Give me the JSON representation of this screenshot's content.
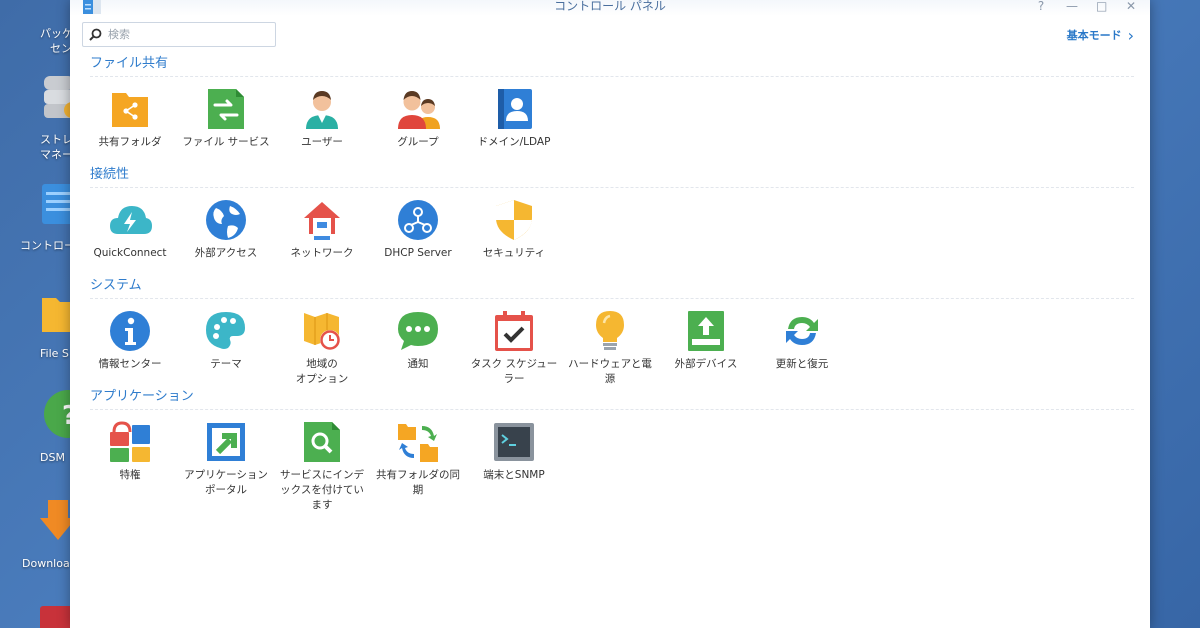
{
  "desktop": {
    "items": [
      {
        "label_1": "パッケ",
        "label_2": "セン"
      },
      {
        "label_1": "ストレ",
        "label_2": "マネー"
      },
      {
        "label_1": "コントロー",
        "label_2": ""
      },
      {
        "label_1": "File S",
        "label_2": ""
      },
      {
        "label_1": "DSM",
        "label_2": ""
      },
      {
        "label_1": "Downloa",
        "label_2": ""
      }
    ]
  },
  "window": {
    "title": "コントロール パネル",
    "controls": {
      "help": "?",
      "minimize": "—",
      "maximize": "□",
      "close": "✕"
    }
  },
  "search": {
    "placeholder": "検索"
  },
  "basic_mode": {
    "label": "基本モード",
    "chevron": "›"
  },
  "sections": [
    {
      "title": "ファイル共有",
      "items": [
        {
          "label": "共有フォルダ",
          "icon": "shared-folder-icon"
        },
        {
          "label": "ファイル サービス",
          "icon": "file-services-icon"
        },
        {
          "label": "ユーザー",
          "icon": "user-icon"
        },
        {
          "label": "グループ",
          "icon": "group-icon"
        },
        {
          "label": "ドメイン/LDAP",
          "icon": "domain-ldap-icon"
        }
      ]
    },
    {
      "title": "接続性",
      "items": [
        {
          "label": "QuickConnect",
          "icon": "quickconnect-icon"
        },
        {
          "label": "外部アクセス",
          "icon": "globe-icon"
        },
        {
          "label": "ネットワーク",
          "icon": "network-house-icon"
        },
        {
          "label": "DHCP Server",
          "icon": "dhcp-icon"
        },
        {
          "label": "セキュリティ",
          "icon": "shield-icon"
        }
      ]
    },
    {
      "title": "システム",
      "items": [
        {
          "label": "情報センター",
          "label_2": "",
          "icon": "info-icon"
        },
        {
          "label": "テーマ",
          "label_2": "",
          "icon": "palette-icon"
        },
        {
          "label": "地域の",
          "label_2": "オプション",
          "icon": "map-clock-icon"
        },
        {
          "label": "通知",
          "label_2": "",
          "icon": "chat-bubble-icon"
        },
        {
          "label": "タスク スケジュー",
          "label_2": "ラー",
          "icon": "calendar-check-icon"
        },
        {
          "label": "ハードウェアと電",
          "label_2": "源",
          "icon": "lightbulb-icon"
        },
        {
          "label": "外部デバイス",
          "label_2": "",
          "icon": "upload-device-icon"
        },
        {
          "label": "更新と復元",
          "label_2": "",
          "icon": "refresh-icon"
        }
      ]
    },
    {
      "title": "アプリケーション",
      "items": [
        {
          "label": "特権",
          "label_2": "",
          "label_3": "",
          "icon": "privileges-icon"
        },
        {
          "label": "アプリケーション",
          "label_2": "ポータル",
          "label_3": "",
          "icon": "app-portal-icon"
        },
        {
          "label": "サービスにインデ",
          "label_2": "ックスを付けてい",
          "label_3": "ます",
          "icon": "indexing-search-icon"
        },
        {
          "label": "共有フォルダの同",
          "label_2": "期",
          "label_3": "",
          "icon": "folder-sync-icon"
        },
        {
          "label": "端末とSNMP",
          "label_2": "",
          "label_3": "",
          "icon": "terminal-icon"
        }
      ]
    }
  ],
  "colors": {
    "accent": "#2f7ccc",
    "desktop_bg": "#4a7cbd"
  }
}
